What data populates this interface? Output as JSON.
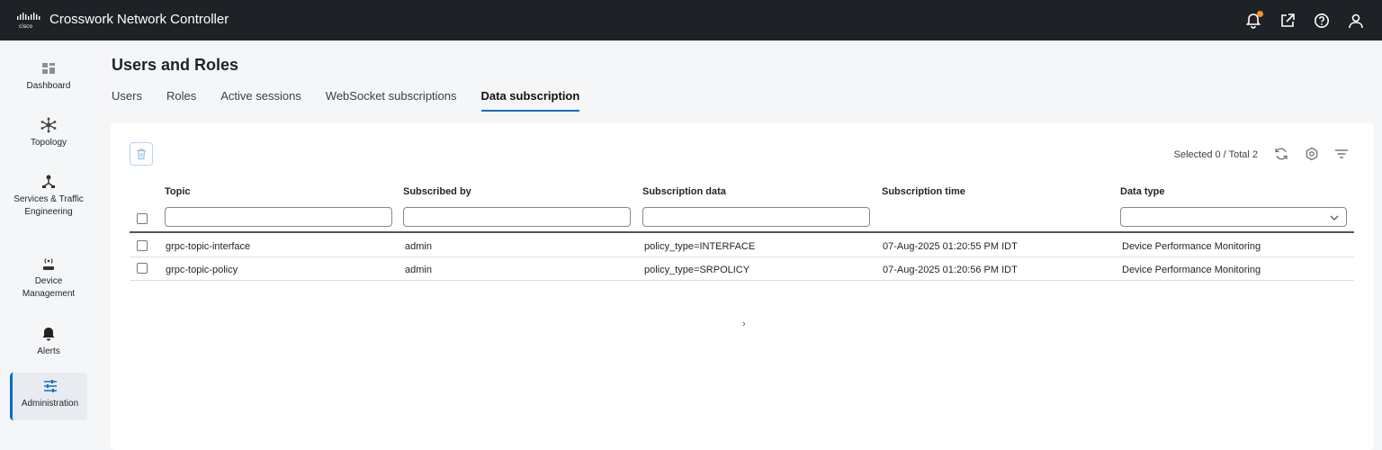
{
  "app": {
    "title": "Crosswork Network Controller",
    "logo_icon": "cisco-logo"
  },
  "topbar": {
    "icons": [
      "bell-icon",
      "external-link-icon",
      "help-icon",
      "user-icon"
    ],
    "notification_color": "#f7941d"
  },
  "sidebar": {
    "items": [
      {
        "label": "Dashboard",
        "icon": "dashboard-icon"
      },
      {
        "label": "Topology",
        "icon": "topology-icon"
      },
      {
        "label": "Services & Traffic Engineering",
        "icon": "services-icon"
      },
      {
        "label": "Device Management",
        "icon": "device-icon"
      },
      {
        "label": "Alerts",
        "icon": "bell-icon"
      },
      {
        "label": "Administration",
        "icon": "sliders-icon"
      }
    ],
    "active": "Administration"
  },
  "page": {
    "title": "Users and Roles",
    "tabs": [
      {
        "label": "Users"
      },
      {
        "label": "Roles"
      },
      {
        "label": "Active sessions"
      },
      {
        "label": "WebSocket subscriptions"
      },
      {
        "label": "Data subscription"
      }
    ],
    "active_tab": "Data subscription"
  },
  "toolbar": {
    "selection_info": "Selected 0 / Total 2"
  },
  "table": {
    "columns": [
      "Topic",
      "Subscribed by",
      "Subscription data",
      "Subscription time",
      "Data type"
    ],
    "filters": {
      "topic": "",
      "subscribed_by": "",
      "subscription_data": "",
      "data_type": ""
    },
    "rows": [
      {
        "topic": "grpc-topic-interface",
        "subscribed_by": "admin",
        "subscription_data": "policy_type=INTERFACE",
        "subscription_time": "07-Aug-2025 01:20:55 PM IDT",
        "data_type": "Device Performance Monitoring"
      },
      {
        "topic": "grpc-topic-policy",
        "subscribed_by": "admin",
        "subscription_data": "policy_type=SRPOLICY",
        "subscription_time": "07-Aug-2025 01:20:56 PM IDT",
        "data_type": "Device Performance Monitoring"
      }
    ]
  },
  "colors": {
    "accent": "#0d6ec7",
    "topbar": "#1e2226"
  }
}
